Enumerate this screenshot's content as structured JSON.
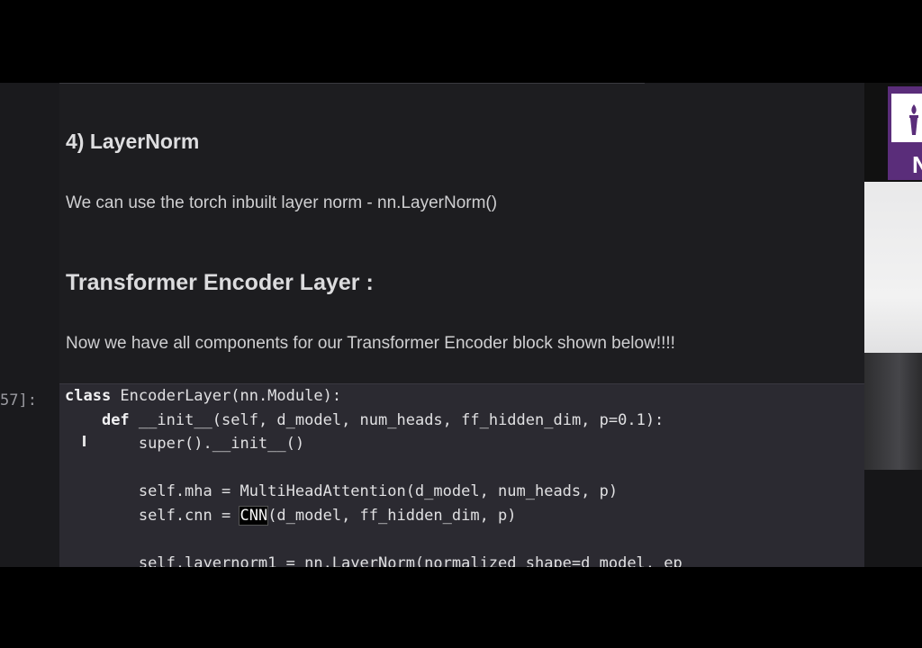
{
  "markdown": {
    "heading_layernorm": "4) LayerNorm",
    "layernorm_text": "We can use the torch inbuilt layer norm - nn.LayerNorm()",
    "heading_encoder": "Transformer Encoder Layer :",
    "encoder_text": "Now we have all components for our Transformer Encoder block shown below!!!!"
  },
  "code_cell": {
    "prompt": "57]:",
    "highlighted_token": "CNN"
  },
  "side_panel": {
    "logo_text": "NY"
  },
  "colors": {
    "background": "#1d1d20",
    "code_background": "#2b2a31",
    "text": "#cfcfd1",
    "logo_purple": "#5a2d7a"
  }
}
